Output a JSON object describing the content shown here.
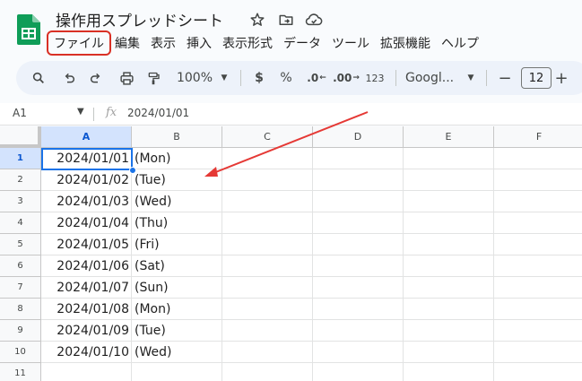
{
  "document": {
    "title": "操作用スプレッドシート"
  },
  "menu": {
    "items": [
      "ファイル",
      "編集",
      "表示",
      "挿入",
      "表示形式",
      "データ",
      "ツール",
      "拡張機能",
      "ヘルプ"
    ],
    "highlighted_index": 0
  },
  "toolbar": {
    "zoom": "100%",
    "currency": "$",
    "percent": "%",
    "decrease_decimal": ".0",
    "increase_decimal": ".00",
    "number_format": "123",
    "font": "Googl...",
    "font_size": "12",
    "minus": "−",
    "plus": "+"
  },
  "formula_bar": {
    "cell_ref": "A1",
    "fx": "fx",
    "value": "2024/01/01"
  },
  "grid": {
    "columns": [
      "A",
      "B",
      "C",
      "D",
      "E",
      "F"
    ],
    "rows": [
      {
        "num": "1",
        "a": "2024/01/01",
        "b": "(Mon)"
      },
      {
        "num": "2",
        "a": "2024/01/02",
        "b": "(Tue)"
      },
      {
        "num": "3",
        "a": "2024/01/03",
        "b": "(Wed)"
      },
      {
        "num": "4",
        "a": "2024/01/04",
        "b": "(Thu)"
      },
      {
        "num": "5",
        "a": "2024/01/05",
        "b": "(Fri)"
      },
      {
        "num": "6",
        "a": "2024/01/06",
        "b": "(Sat)"
      },
      {
        "num": "7",
        "a": "2024/01/07",
        "b": "(Sun)"
      },
      {
        "num": "8",
        "a": "2024/01/08",
        "b": "(Mon)"
      },
      {
        "num": "9",
        "a": "2024/01/09",
        "b": "(Tue)"
      },
      {
        "num": "10",
        "a": "2024/01/10",
        "b": "(Wed)"
      },
      {
        "num": "11",
        "a": "",
        "b": ""
      }
    ],
    "active_cell": "A1"
  },
  "colors": {
    "accent": "#1a73e8",
    "annotation": "#e53935",
    "sheets_green": "#0f9d58"
  }
}
